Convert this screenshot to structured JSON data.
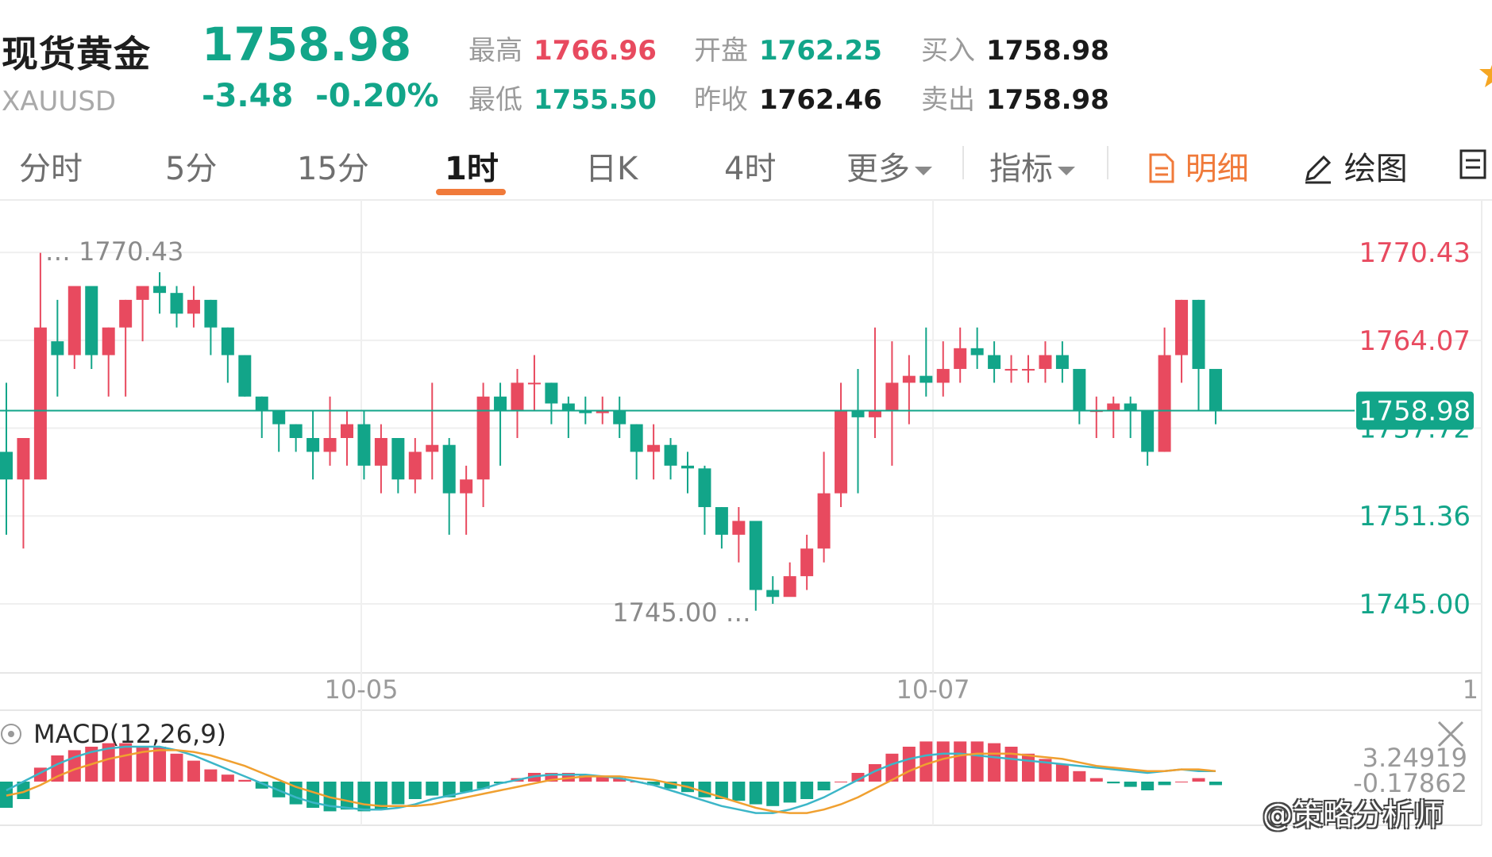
{
  "header": {
    "name": "现货黄金",
    "symbol": "XAUUSD",
    "price": "1758.98",
    "change": "-3.48",
    "change_pct": "-0.20%",
    "stats": [
      {
        "label": "最高",
        "value": "1766.96",
        "color": "#e84a5f"
      },
      {
        "label": "最低",
        "value": "1755.50",
        "color": "#12a589"
      },
      {
        "label": "开盘",
        "value": "1762.25",
        "color": "#12a589"
      },
      {
        "label": "昨收",
        "value": "1762.46",
        "color": "#1a1a1a"
      },
      {
        "label": "买入",
        "value": "1758.98",
        "color": "#1a1a1a"
      },
      {
        "label": "卖出",
        "value": "1758.98",
        "color": "#1a1a1a"
      }
    ]
  },
  "tabs": [
    {
      "label": "分时"
    },
    {
      "label": "5分"
    },
    {
      "label": "15分"
    },
    {
      "label": "1时"
    },
    {
      "label": "日K"
    },
    {
      "label": "4时"
    },
    {
      "label": "更多"
    },
    {
      "label": "指标"
    },
    {
      "label": "明细"
    },
    {
      "label": "绘图"
    }
  ],
  "active_tab": "1时",
  "colors": {
    "up": "#e84a5f",
    "down": "#12a589",
    "accent": "#f07a3a",
    "dif": "#3cb6c8",
    "dea": "#f0a030"
  },
  "chart_data": {
    "type": "candlestick",
    "price_axis_labels": [
      "1770.43",
      "1764.07",
      "1757.72",
      "1751.36",
      "1745.00"
    ],
    "current_price_tag": "1758.98",
    "x_labels": [
      "10-05",
      "10-07"
    ],
    "edge_label": "1",
    "high_annotation": "1770.43",
    "low_annotation": "1745.00",
    "ylim": [
      1740,
      1774
    ],
    "candles": [
      [
        1756,
        1754,
        1761,
        1750
      ],
      [
        1754,
        1757,
        1757,
        1749
      ],
      [
        1754,
        1765,
        1770.4,
        1754
      ],
      [
        1764,
        1763,
        1767,
        1760
      ],
      [
        1763,
        1768,
        1768,
        1762
      ],
      [
        1768,
        1763,
        1768,
        1762
      ],
      [
        1763,
        1765,
        1765,
        1760
      ],
      [
        1765,
        1767,
        1767,
        1760
      ],
      [
        1767,
        1768,
        1768,
        1764
      ],
      [
        1768,
        1767.5,
        1769,
        1766
      ],
      [
        1767.5,
        1766,
        1768,
        1765
      ],
      [
        1766,
        1767,
        1768,
        1765
      ],
      [
        1767,
        1765,
        1767,
        1763
      ],
      [
        1765,
        1763,
        1765,
        1761
      ],
      [
        1763,
        1760,
        1763,
        1760
      ],
      [
        1760,
        1759,
        1760,
        1757
      ],
      [
        1759,
        1758,
        1759,
        1756
      ],
      [
        1758,
        1757,
        1758,
        1756
      ],
      [
        1757,
        1756,
        1759,
        1754
      ],
      [
        1756,
        1757,
        1760,
        1755
      ],
      [
        1757,
        1758,
        1759,
        1755
      ],
      [
        1758,
        1755,
        1759,
        1754
      ],
      [
        1755,
        1757,
        1758,
        1753
      ],
      [
        1757,
        1754,
        1757,
        1753
      ],
      [
        1754,
        1756,
        1757,
        1753
      ],
      [
        1756,
        1756.5,
        1761,
        1754
      ],
      [
        1756.5,
        1753,
        1757,
        1750
      ],
      [
        1753,
        1754,
        1755,
        1750
      ],
      [
        1754,
        1760,
        1761,
        1752
      ],
      [
        1760,
        1759,
        1761,
        1755
      ],
      [
        1759,
        1761,
        1762,
        1757
      ],
      [
        1761,
        1761,
        1763,
        1759
      ],
      [
        1761,
        1759.5,
        1761,
        1758
      ],
      [
        1759.5,
        1759,
        1760,
        1757
      ],
      [
        1759,
        1758.8,
        1760,
        1758
      ],
      [
        1758.8,
        1759,
        1760,
        1758
      ],
      [
        1759,
        1758,
        1760,
        1757
      ],
      [
        1758,
        1756,
        1758,
        1754
      ],
      [
        1756,
        1756.5,
        1758,
        1754
      ],
      [
        1756.5,
        1755,
        1757,
        1754
      ],
      [
        1755,
        1754.8,
        1756,
        1753
      ],
      [
        1754.8,
        1752,
        1755,
        1750
      ],
      [
        1752,
        1750,
        1752,
        1749
      ],
      [
        1750,
        1751,
        1752,
        1748
      ],
      [
        1751,
        1746,
        1751,
        1744.5
      ],
      [
        1746,
        1745.5,
        1747,
        1745
      ],
      [
        1745.5,
        1747,
        1748,
        1746
      ],
      [
        1747,
        1749,
        1750,
        1746
      ],
      [
        1749,
        1753,
        1756,
        1748
      ],
      [
        1753,
        1759,
        1761,
        1752
      ],
      [
        1759,
        1758.5,
        1762,
        1753
      ],
      [
        1758.5,
        1759,
        1765,
        1757
      ],
      [
        1759,
        1761,
        1764,
        1755
      ],
      [
        1761,
        1761.5,
        1763,
        1758
      ],
      [
        1761.5,
        1761,
        1765,
        1760
      ],
      [
        1761,
        1762,
        1764,
        1760
      ],
      [
        1762,
        1763.5,
        1765,
        1761
      ],
      [
        1763.5,
        1763,
        1765,
        1762
      ],
      [
        1763,
        1762,
        1764,
        1761
      ],
      [
        1762,
        1762,
        1763,
        1761
      ],
      [
        1762,
        1762,
        1763,
        1761
      ],
      [
        1762,
        1763,
        1764,
        1761
      ],
      [
        1763,
        1762,
        1764,
        1761
      ],
      [
        1762,
        1759,
        1762,
        1758
      ],
      [
        1759,
        1759,
        1760,
        1757
      ],
      [
        1759,
        1759.5,
        1760,
        1757
      ],
      [
        1759.5,
        1759,
        1760,
        1757
      ],
      [
        1759,
        1756,
        1759,
        1755
      ],
      [
        1756,
        1763,
        1765,
        1756
      ],
      [
        1763,
        1767,
        1767,
        1761
      ],
      [
        1767,
        1762,
        1767,
        1759
      ],
      [
        1762,
        1759,
        1762,
        1758
      ]
    ],
    "macd": {
      "label": "MACD(12,26,9)",
      "values": [
        "3.24919",
        "-0.17862"
      ],
      "hist": [
        -1.5,
        -1,
        0.8,
        1.5,
        1.8,
        2.0,
        2.2,
        2.2,
        2.0,
        2.0,
        1.6,
        1.2,
        0.7,
        0.4,
        0.1,
        -0.4,
        -0.9,
        -1.3,
        -1.5,
        -1.7,
        -1.6,
        -1.7,
        -1.6,
        -1.3,
        -1.0,
        -0.8,
        -0.9,
        -0.6,
        -0.4,
        -0.1,
        0.2,
        0.5,
        0.5,
        0.5,
        0.4,
        0.3,
        0.2,
        0.0,
        -0.2,
        -0.4,
        -0.6,
        -0.9,
        -1.0,
        -1.1,
        -1.3,
        -1.4,
        -1.2,
        -1.0,
        -0.5,
        0.0,
        0.5,
        1.0,
        1.6,
        2.0,
        2.3,
        2.3,
        2.3,
        2.3,
        2.2,
        2.0,
        1.6,
        1.3,
        1.0,
        0.6,
        0.2,
        -0.1,
        -0.3,
        -0.5,
        -0.2,
        0.0,
        0.2,
        -0.2
      ],
      "dif": [
        -0.5,
        0.0,
        0.5,
        1.0,
        1.4,
        1.7,
        1.9,
        2.0,
        2.0,
        2.0,
        1.8,
        1.5,
        1.1,
        0.7,
        0.3,
        -0.1,
        -0.5,
        -0.9,
        -1.2,
        -1.4,
        -1.5,
        -1.6,
        -1.6,
        -1.5,
        -1.3,
        -1.0,
        -0.8,
        -0.6,
        -0.4,
        -0.1,
        0.1,
        0.3,
        0.4,
        0.4,
        0.4,
        0.3,
        0.2,
        0.0,
        -0.2,
        -0.5,
        -0.8,
        -1.1,
        -1.4,
        -1.6,
        -1.8,
        -1.8,
        -1.6,
        -1.3,
        -0.9,
        -0.4,
        0.1,
        0.6,
        1.0,
        1.3,
        1.5,
        1.6,
        1.6,
        1.5,
        1.4,
        1.3,
        1.2,
        1.1,
        1.0,
        0.9,
        0.8,
        0.7,
        0.6,
        0.5,
        0.6,
        0.7,
        0.6,
        0.6
      ],
      "dea": [
        -0.8,
        -0.6,
        -0.2,
        0.3,
        0.7,
        1.0,
        1.3,
        1.5,
        1.7,
        1.8,
        1.8,
        1.7,
        1.5,
        1.2,
        0.9,
        0.5,
        0.1,
        -0.3,
        -0.6,
        -0.9,
        -1.1,
        -1.3,
        -1.4,
        -1.4,
        -1.4,
        -1.3,
        -1.1,
        -0.9,
        -0.7,
        -0.5,
        -0.3,
        -0.1,
        0.1,
        0.2,
        0.3,
        0.3,
        0.3,
        0.2,
        0.1,
        -0.1,
        -0.3,
        -0.6,
        -0.9,
        -1.2,
        -1.5,
        -1.7,
        -1.8,
        -1.8,
        -1.6,
        -1.3,
        -0.9,
        -0.4,
        0.1,
        0.6,
        1.0,
        1.3,
        1.5,
        1.6,
        1.6,
        1.6,
        1.5,
        1.4,
        1.3,
        1.1,
        0.9,
        0.8,
        0.7,
        0.6,
        0.6,
        0.7,
        0.7,
        0.6
      ]
    }
  },
  "watermark": "@策略分析师"
}
